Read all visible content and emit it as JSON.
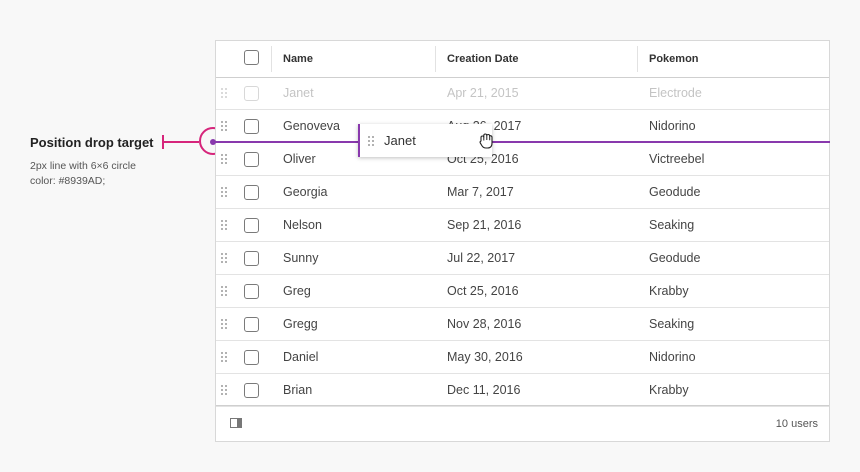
{
  "annotation": {
    "title": "Position drop target",
    "description": "2px line with 6×6 circle\ncolor: #8939AD;",
    "marker_color": "#d6257b"
  },
  "drop_indicator": {
    "color": "#8939AD"
  },
  "grid": {
    "columns": [
      "Name",
      "Creation Date",
      "Pokemon"
    ],
    "rows": [
      {
        "name": "Janet",
        "date": "Apr 21, 2015",
        "pokemon": "Electrode",
        "state": "dragging"
      },
      {
        "name": "Genoveva",
        "date": "Aug 26, 2017",
        "pokemon": "Nidorino"
      },
      {
        "name": "Oliver",
        "date": "Oct 25, 2016",
        "pokemon": "Victreebel"
      },
      {
        "name": "Georgia",
        "date": "Mar 7, 2017",
        "pokemon": "Geodude"
      },
      {
        "name": "Nelson",
        "date": "Sep 21, 2016",
        "pokemon": "Seaking"
      },
      {
        "name": "Sunny",
        "date": "Jul 22, 2017",
        "pokemon": "Geodude"
      },
      {
        "name": "Greg",
        "date": "Oct 25, 2016",
        "pokemon": "Krabby"
      },
      {
        "name": "Gregg",
        "date": "Nov 28, 2016",
        "pokemon": "Seaking"
      },
      {
        "name": "Daniel",
        "date": "May 30, 2016",
        "pokemon": "Nidorino"
      },
      {
        "name": "Brian",
        "date": "Dec 11, 2016",
        "pokemon": "Krabby"
      }
    ],
    "footer": {
      "count": "10 users",
      "icon": "column-panel-icon"
    }
  },
  "drag_ghost": {
    "label": "Janet",
    "cursor": "grab-hand-icon"
  }
}
